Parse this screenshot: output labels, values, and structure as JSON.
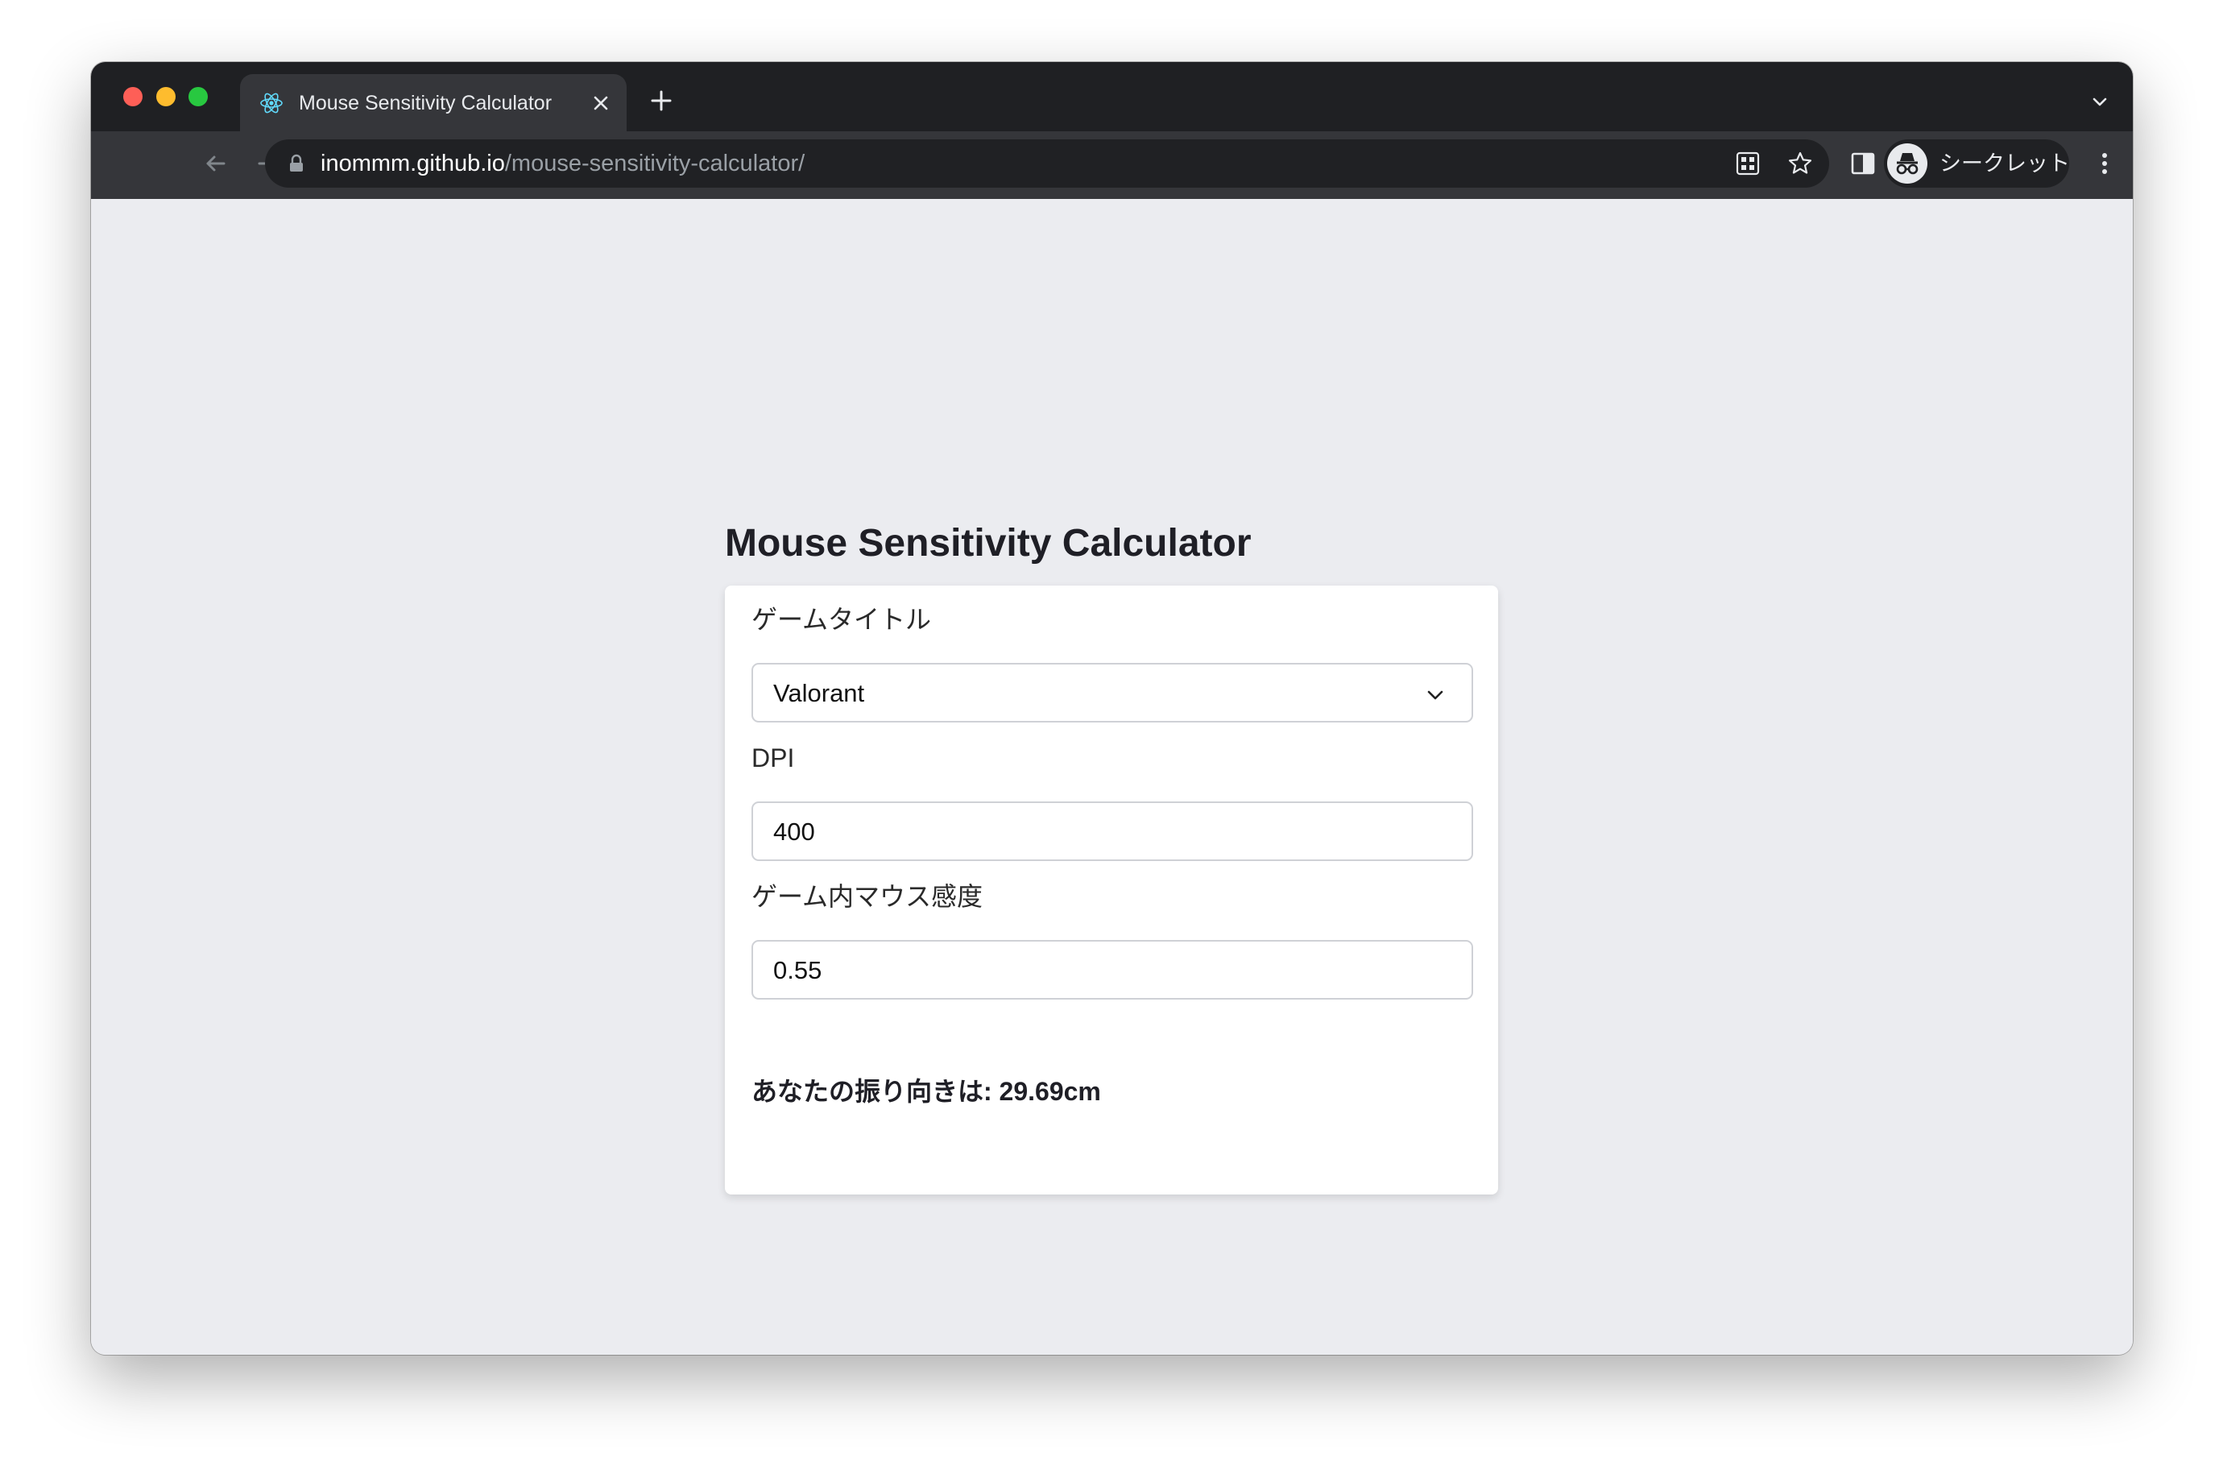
{
  "browser": {
    "tab": {
      "title": "Mouse Sensitivity Calculator",
      "icon": "react-icon"
    },
    "url": {
      "host": "inommm.github.io",
      "path": "/mouse-sensitivity-calculator/"
    },
    "profile_label": "シークレット"
  },
  "page": {
    "title": "Mouse Sensitivity Calculator",
    "form": {
      "game_label": "ゲームタイトル",
      "game_value": "Valorant",
      "dpi_label": "DPI",
      "dpi_value": "400",
      "sens_label": "ゲーム内マウス感度",
      "sens_value": "0.55"
    },
    "result": "あなたの振り向きは: 29.69cm"
  },
  "colors": {
    "page_background": "#ebecf0",
    "card_background": "#ffffff",
    "titlebar": "#1f2023",
    "toolbar": "#35363a",
    "tab_icon_accent": "#61dafb"
  }
}
